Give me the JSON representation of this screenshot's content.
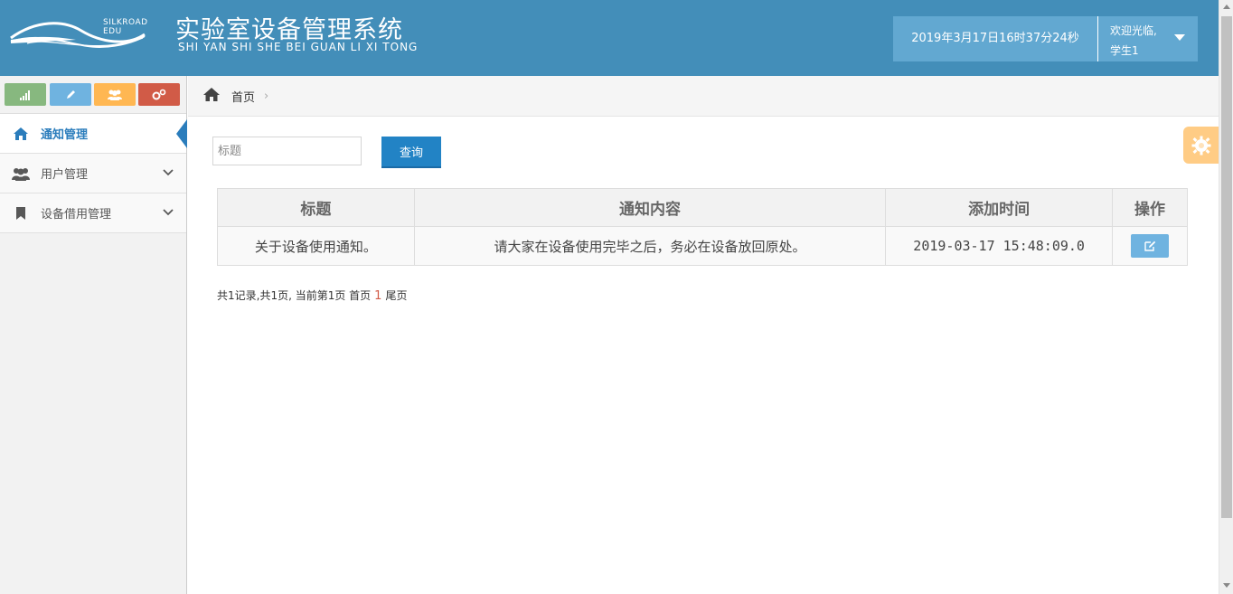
{
  "header": {
    "logo_text": "SILKROAD EDU",
    "title": "实验室设备管理系统",
    "subtitle": "SHI YAN SHI SHE BEI GUAN LI XI TONG",
    "datetime": "2019年3月17日16时37分24秒",
    "welcome_line1": "欢迎光临,",
    "welcome_line2": "学生1"
  },
  "sidebar": {
    "shortcuts": [
      {
        "icon": "signal-icon",
        "color": "#87b87f"
      },
      {
        "icon": "pencil-icon",
        "color": "#6fb3e0"
      },
      {
        "icon": "users-icon",
        "color": "#ffb752"
      },
      {
        "icon": "cogs-icon",
        "color": "#d15b47"
      }
    ],
    "items": [
      {
        "label": "通知管理",
        "icon": "home-icon",
        "active": true
      },
      {
        "label": "用户管理",
        "icon": "users-icon",
        "active": false
      },
      {
        "label": "设备借用管理",
        "icon": "bookmark-icon",
        "active": false
      }
    ]
  },
  "breadcrumb": {
    "home_label": "首页"
  },
  "search": {
    "placeholder": "标题",
    "button_label": "查询"
  },
  "table": {
    "headers": [
      "标题",
      "通知内容",
      "添加时间",
      "操作"
    ],
    "rows": [
      {
        "title": "关于设备使用通知。",
        "content": "请大家在设备使用完毕之后，务必在设备放回原处。",
        "time": "2019-03-17 15:48:09.0"
      }
    ]
  },
  "pager": {
    "summary": "共1记录,共1页, 当前第1页 首页",
    "current": "1",
    "last": "尾页"
  },
  "colors": {
    "header_bg": "#438eb9",
    "header_box": "#62a8d1",
    "primary_button": "#2283c5",
    "active_menu": "#2b7dbc"
  }
}
